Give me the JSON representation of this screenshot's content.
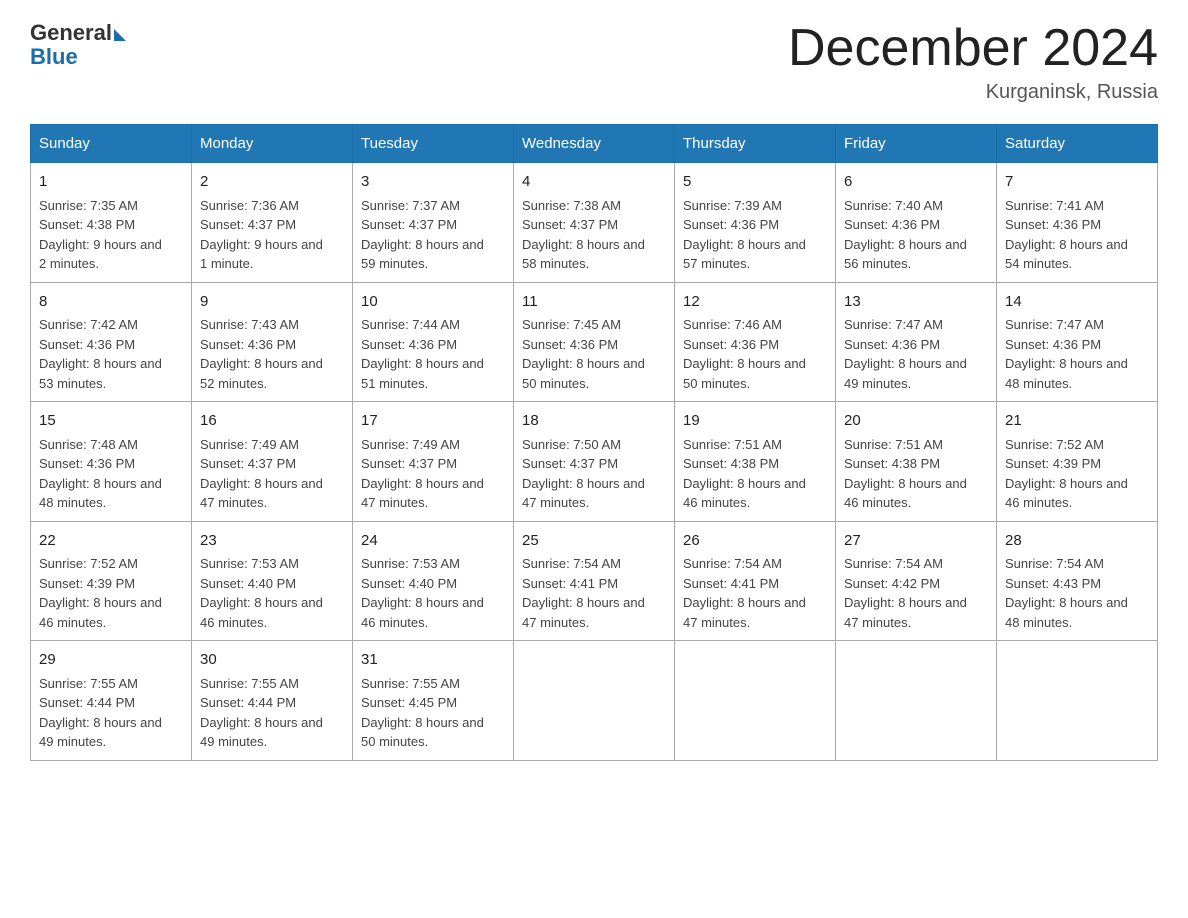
{
  "header": {
    "logo_general": "General",
    "logo_blue": "Blue",
    "month_title": "December 2024",
    "location": "Kurganinsk, Russia"
  },
  "days_of_week": [
    "Sunday",
    "Monday",
    "Tuesday",
    "Wednesday",
    "Thursday",
    "Friday",
    "Saturday"
  ],
  "weeks": [
    [
      {
        "day": "1",
        "sunrise": "7:35 AM",
        "sunset": "4:38 PM",
        "daylight": "9 hours and 2 minutes."
      },
      {
        "day": "2",
        "sunrise": "7:36 AM",
        "sunset": "4:37 PM",
        "daylight": "9 hours and 1 minute."
      },
      {
        "day": "3",
        "sunrise": "7:37 AM",
        "sunset": "4:37 PM",
        "daylight": "8 hours and 59 minutes."
      },
      {
        "day": "4",
        "sunrise": "7:38 AM",
        "sunset": "4:37 PM",
        "daylight": "8 hours and 58 minutes."
      },
      {
        "day": "5",
        "sunrise": "7:39 AM",
        "sunset": "4:36 PM",
        "daylight": "8 hours and 57 minutes."
      },
      {
        "day": "6",
        "sunrise": "7:40 AM",
        "sunset": "4:36 PM",
        "daylight": "8 hours and 56 minutes."
      },
      {
        "day": "7",
        "sunrise": "7:41 AM",
        "sunset": "4:36 PM",
        "daylight": "8 hours and 54 minutes."
      }
    ],
    [
      {
        "day": "8",
        "sunrise": "7:42 AM",
        "sunset": "4:36 PM",
        "daylight": "8 hours and 53 minutes."
      },
      {
        "day": "9",
        "sunrise": "7:43 AM",
        "sunset": "4:36 PM",
        "daylight": "8 hours and 52 minutes."
      },
      {
        "day": "10",
        "sunrise": "7:44 AM",
        "sunset": "4:36 PM",
        "daylight": "8 hours and 51 minutes."
      },
      {
        "day": "11",
        "sunrise": "7:45 AM",
        "sunset": "4:36 PM",
        "daylight": "8 hours and 50 minutes."
      },
      {
        "day": "12",
        "sunrise": "7:46 AM",
        "sunset": "4:36 PM",
        "daylight": "8 hours and 50 minutes."
      },
      {
        "day": "13",
        "sunrise": "7:47 AM",
        "sunset": "4:36 PM",
        "daylight": "8 hours and 49 minutes."
      },
      {
        "day": "14",
        "sunrise": "7:47 AM",
        "sunset": "4:36 PM",
        "daylight": "8 hours and 48 minutes."
      }
    ],
    [
      {
        "day": "15",
        "sunrise": "7:48 AM",
        "sunset": "4:36 PM",
        "daylight": "8 hours and 48 minutes."
      },
      {
        "day": "16",
        "sunrise": "7:49 AM",
        "sunset": "4:37 PM",
        "daylight": "8 hours and 47 minutes."
      },
      {
        "day": "17",
        "sunrise": "7:49 AM",
        "sunset": "4:37 PM",
        "daylight": "8 hours and 47 minutes."
      },
      {
        "day": "18",
        "sunrise": "7:50 AM",
        "sunset": "4:37 PM",
        "daylight": "8 hours and 47 minutes."
      },
      {
        "day": "19",
        "sunrise": "7:51 AM",
        "sunset": "4:38 PM",
        "daylight": "8 hours and 46 minutes."
      },
      {
        "day": "20",
        "sunrise": "7:51 AM",
        "sunset": "4:38 PM",
        "daylight": "8 hours and 46 minutes."
      },
      {
        "day": "21",
        "sunrise": "7:52 AM",
        "sunset": "4:39 PM",
        "daylight": "8 hours and 46 minutes."
      }
    ],
    [
      {
        "day": "22",
        "sunrise": "7:52 AM",
        "sunset": "4:39 PM",
        "daylight": "8 hours and 46 minutes."
      },
      {
        "day": "23",
        "sunrise": "7:53 AM",
        "sunset": "4:40 PM",
        "daylight": "8 hours and 46 minutes."
      },
      {
        "day": "24",
        "sunrise": "7:53 AM",
        "sunset": "4:40 PM",
        "daylight": "8 hours and 46 minutes."
      },
      {
        "day": "25",
        "sunrise": "7:54 AM",
        "sunset": "4:41 PM",
        "daylight": "8 hours and 47 minutes."
      },
      {
        "day": "26",
        "sunrise": "7:54 AM",
        "sunset": "4:41 PM",
        "daylight": "8 hours and 47 minutes."
      },
      {
        "day": "27",
        "sunrise": "7:54 AM",
        "sunset": "4:42 PM",
        "daylight": "8 hours and 47 minutes."
      },
      {
        "day": "28",
        "sunrise": "7:54 AM",
        "sunset": "4:43 PM",
        "daylight": "8 hours and 48 minutes."
      }
    ],
    [
      {
        "day": "29",
        "sunrise": "7:55 AM",
        "sunset": "4:44 PM",
        "daylight": "8 hours and 49 minutes."
      },
      {
        "day": "30",
        "sunrise": "7:55 AM",
        "sunset": "4:44 PM",
        "daylight": "8 hours and 49 minutes."
      },
      {
        "day": "31",
        "sunrise": "7:55 AM",
        "sunset": "4:45 PM",
        "daylight": "8 hours and 50 minutes."
      },
      null,
      null,
      null,
      null
    ]
  ],
  "labels": {
    "sunrise": "Sunrise:",
    "sunset": "Sunset:",
    "daylight": "Daylight:"
  }
}
